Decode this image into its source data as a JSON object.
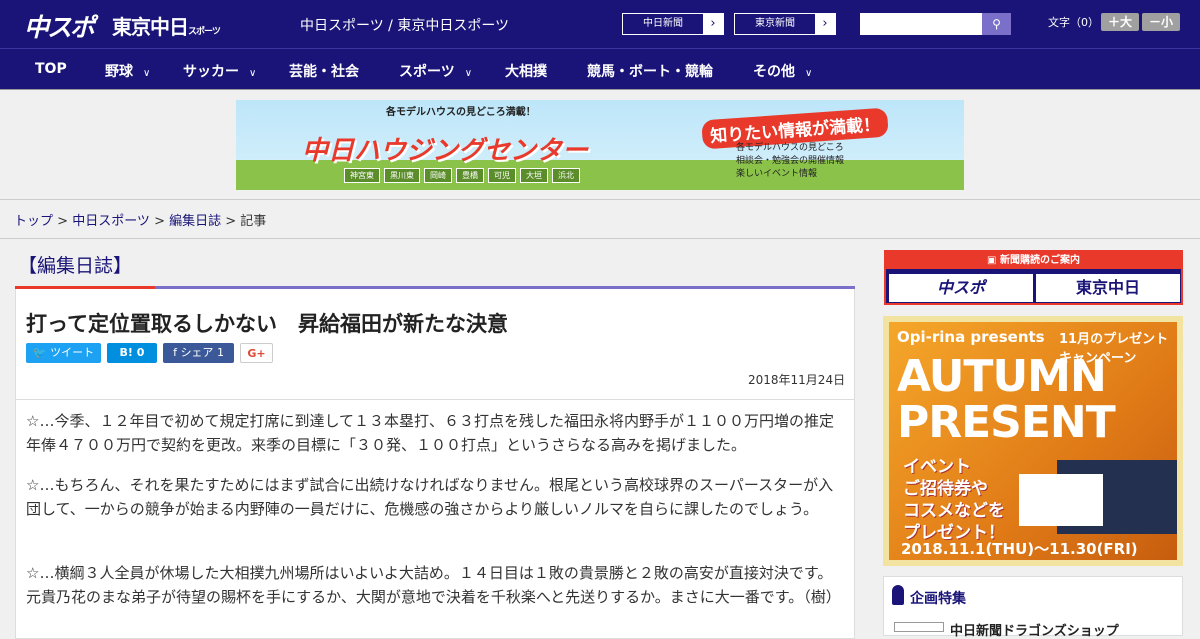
{
  "header": {
    "logo_main": "中スポ",
    "logo_tokyo": "東京中日",
    "logo_tokyo_sub": "スポーツ",
    "site_title": "中日スポーツ / 東京中日スポーツ",
    "paper_buttons": [
      "中日新聞",
      "東京新聞"
    ],
    "search_placeholder": "",
    "font_size_label": "文字（0）",
    "font_plus": "＋大",
    "font_minus": "－小"
  },
  "nav": {
    "items": [
      {
        "label": "TOP",
        "has_menu": false
      },
      {
        "label": "野球",
        "has_menu": true
      },
      {
        "label": "サッカー",
        "has_menu": true
      },
      {
        "label": "芸能・社会",
        "has_menu": false
      },
      {
        "label": "スポーツ",
        "has_menu": true
      },
      {
        "label": "大相撲",
        "has_menu": false
      },
      {
        "label": "競馬・ボート・競輪",
        "has_menu": false
      },
      {
        "label": "その他",
        "has_menu": true
      }
    ]
  },
  "banner": {
    "top": "各モデルハウスの見どころ満載！",
    "main": "中日ハウジングセンター",
    "right": "知りたい情報が満載！",
    "list": [
      "各モデルハウスの見どころ",
      "相談会・勉強会の開催情報",
      "楽しいイベント情報"
    ],
    "tags": [
      "神宮東",
      "黒川東",
      "岡崎",
      "豊橋",
      "可児",
      "大垣",
      "浜北"
    ]
  },
  "breadcrumb": {
    "items": [
      "トップ",
      "中日スポーツ",
      "編集日誌"
    ],
    "current": "記事",
    "sep": " > "
  },
  "section": {
    "label": "【編集日誌】"
  },
  "article": {
    "title": "打って定位置取るしかない　昇給福田が新たな決意",
    "share": {
      "twitter": "ツイート",
      "hatena": "B!",
      "hatena_count": "0",
      "facebook": "シェア",
      "facebook_count": "1",
      "gplus": "G+"
    },
    "date": "2018年11月24日",
    "paragraphs": [
      "☆…今季、１２年目で初めて規定打席に到達して１３本塁打、６３打点を残した福田永将内野手が１１００万円増の推定年俸４７００万円で契約を更改。来季の目標に「３０発、１００打点」というさらなる高みを掲げました。",
      "☆…もちろん、それを果たすためにはまず試合に出続けなければなりません。根尾という高校球界のスーパースターが入団して、一からの競争が始まる内野陣の一員だけに、危機感の強さからより厳しいノルマを自らに課したのでしょう。",
      "☆…横綱３人全員が休場した大相撲九州場所はいよいよ大詰め。１４日目は１敗の貴景勝と２敗の高安が直接対決です。元貴乃花のまな弟子が待望の賜杯を手にするか、大関が意地で決着を千秋楽へと先送りするか。まさに大一番です。（樹）"
    ]
  },
  "sidebar": {
    "subscribe_title": "新聞購読のご案内",
    "subscribe_buttons": [
      "中スポ",
      "東京中日"
    ],
    "ad": {
      "brand": "Opi-rina presents",
      "campaign": "11月のプレゼントキャンペーン",
      "big": [
        "AUTUMN",
        "PRESENT"
      ],
      "mid": [
        "イベント",
        "ご招待券や",
        "コスメなどを",
        "プレゼント！"
      ],
      "dates": "2018.11.1(THU)～11.30(FRI)"
    },
    "feature_title": "企画特集",
    "feature_item": "中日新聞ドラゴンズショップ"
  },
  "colors": {
    "brand": "#1a1478",
    "accent": "#e8392b",
    "twitter": "#1da1f2",
    "hatena": "#008fde",
    "facebook": "#3b5998"
  }
}
